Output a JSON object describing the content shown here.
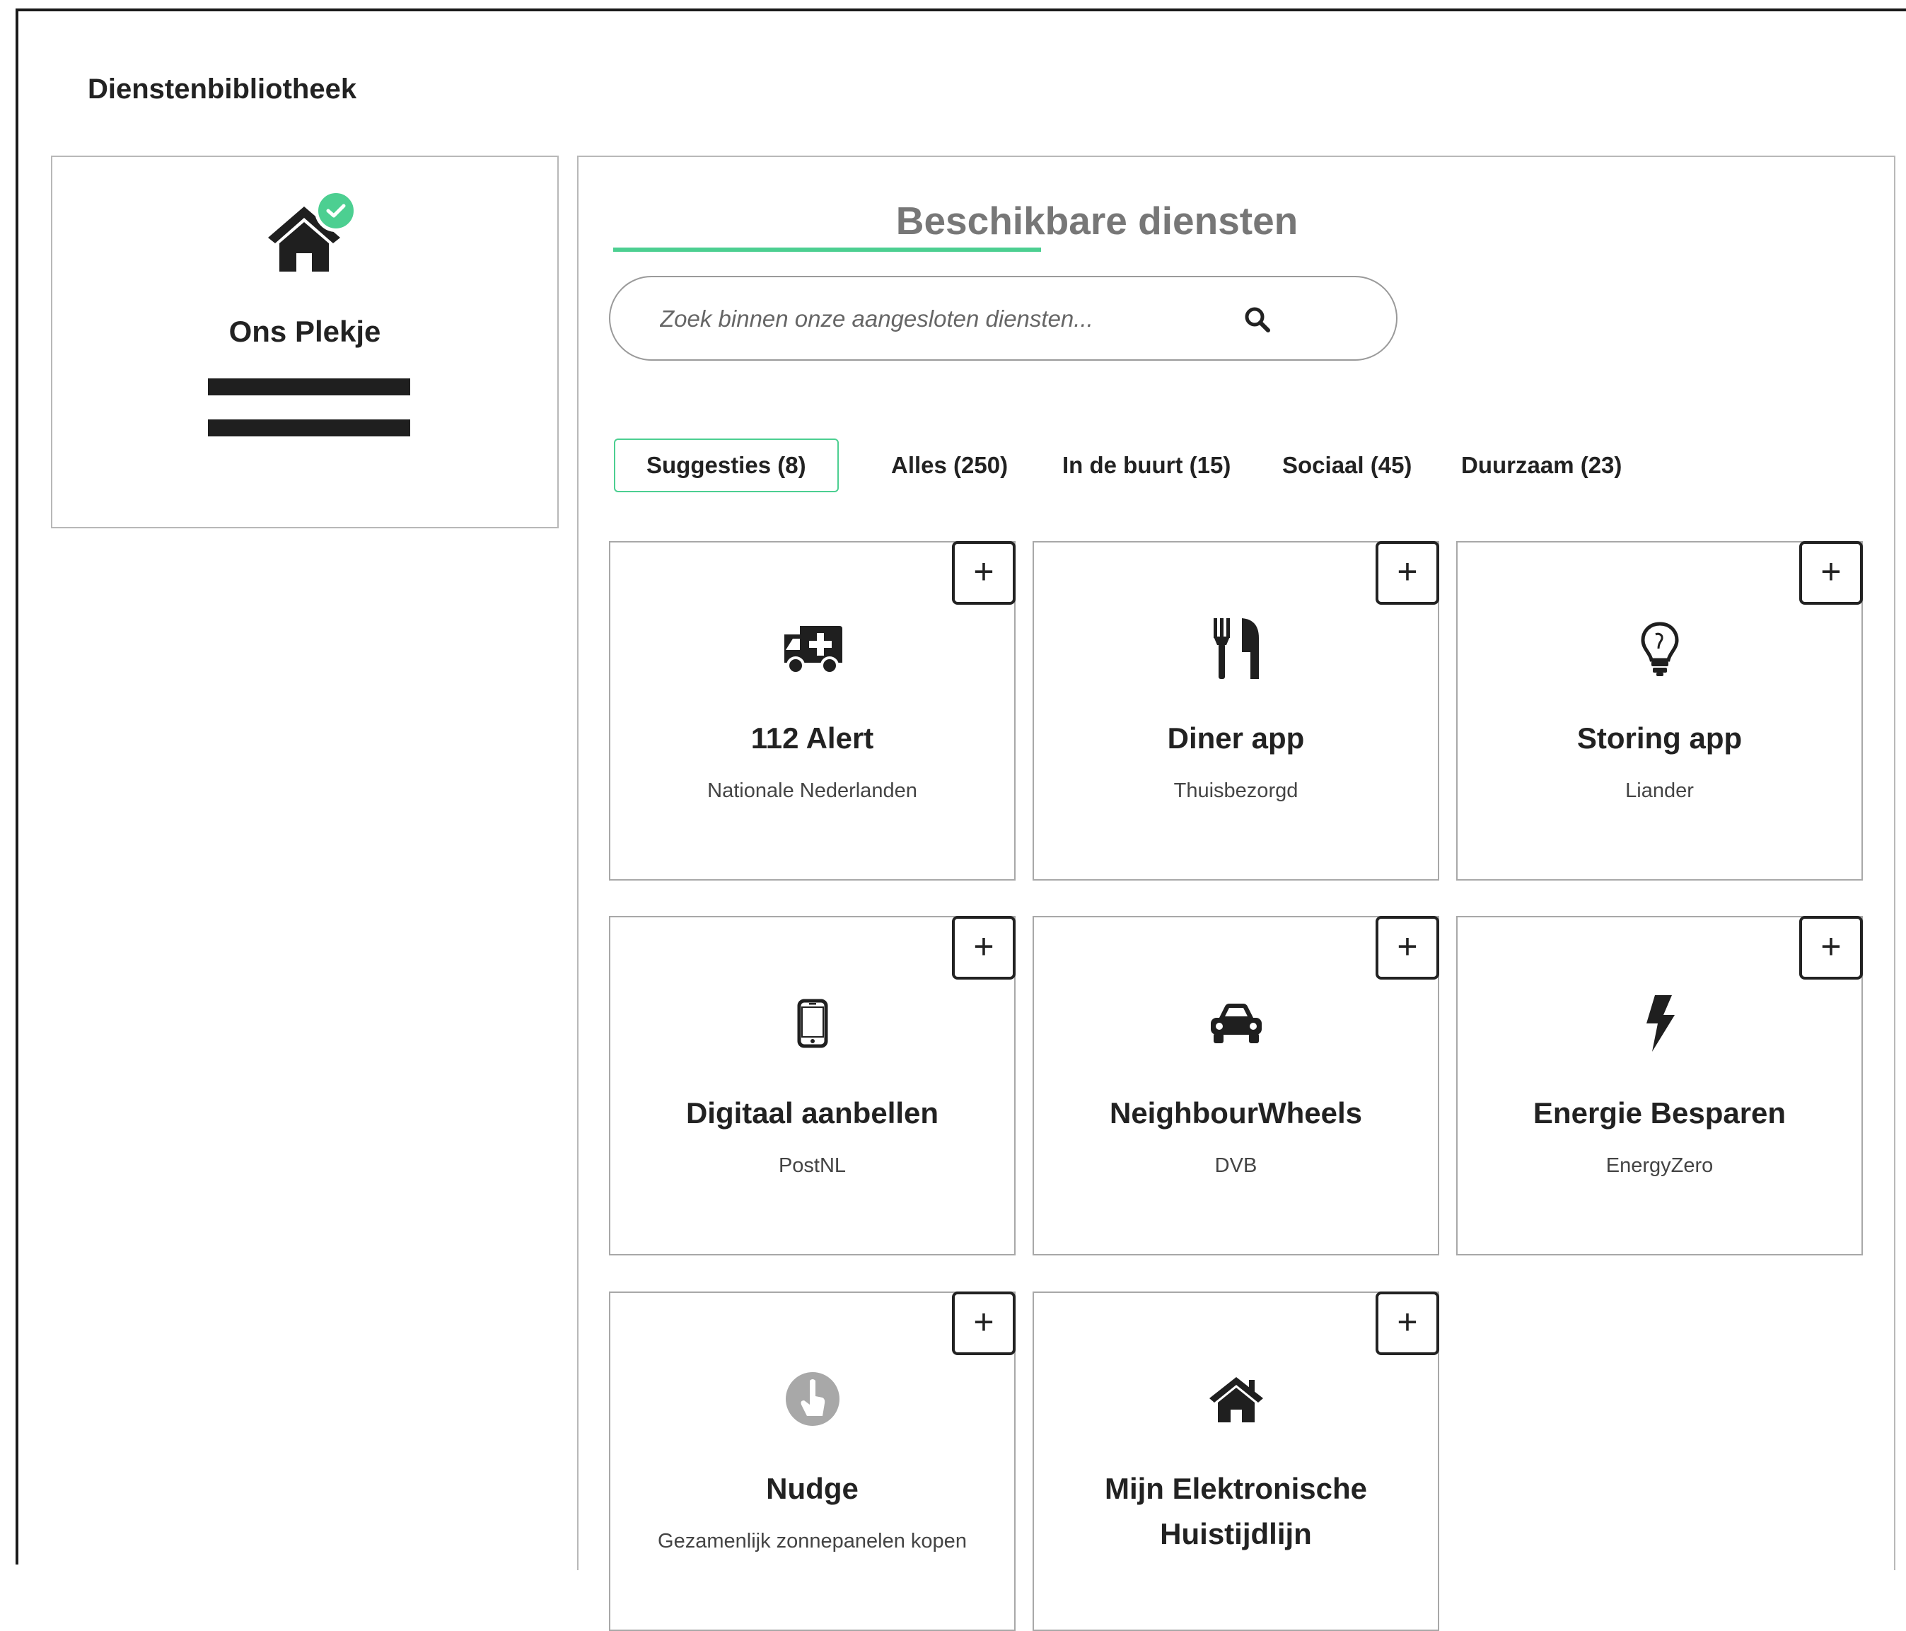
{
  "page": {
    "title": "Dienstenbibliotheek"
  },
  "household": {
    "name": "Ons Plekje",
    "icon": "home-icon",
    "badge_icon": "check-icon"
  },
  "library": {
    "title": "Beschikbare diensten",
    "search": {
      "placeholder": "Zoek binnen onze aangesloten diensten..."
    },
    "tabs": [
      {
        "label": "Suggesties (8)",
        "active": true
      },
      {
        "label": "Alles (250)"
      },
      {
        "label": "In de buurt (15)"
      },
      {
        "label": "Sociaal (45)"
      },
      {
        "label": "Duurzaam (23)"
      }
    ],
    "add_label": "+",
    "services": [
      {
        "name": "112 Alert",
        "provider": "Nationale Nederlanden",
        "icon": "ambulance-icon"
      },
      {
        "name": "Diner app",
        "provider": "Thuisbezorgd",
        "icon": "cutlery-icon"
      },
      {
        "name": "Storing app",
        "provider": "Liander",
        "icon": "lightbulb-icon"
      },
      {
        "name": "Digitaal aanbellen",
        "provider": "PostNL",
        "icon": "mobile-phone-icon"
      },
      {
        "name": "NeighbourWheels",
        "provider": "DVB",
        "icon": "car-icon"
      },
      {
        "name": "Energie Besparen",
        "provider": "EnergyZero",
        "icon": "lightning-bolt-icon"
      },
      {
        "name": "Nudge",
        "provider": "Gezamenlijk zonnepanelen kopen",
        "icon": "pointer-hand-icon"
      },
      {
        "name": "Mijn Elektronische Huistijdlijn",
        "provider": "",
        "icon": "home-icon"
      }
    ]
  },
  "colors": {
    "accent": "#4ccf91",
    "title_gray": "#777777",
    "text": "#222222"
  }
}
